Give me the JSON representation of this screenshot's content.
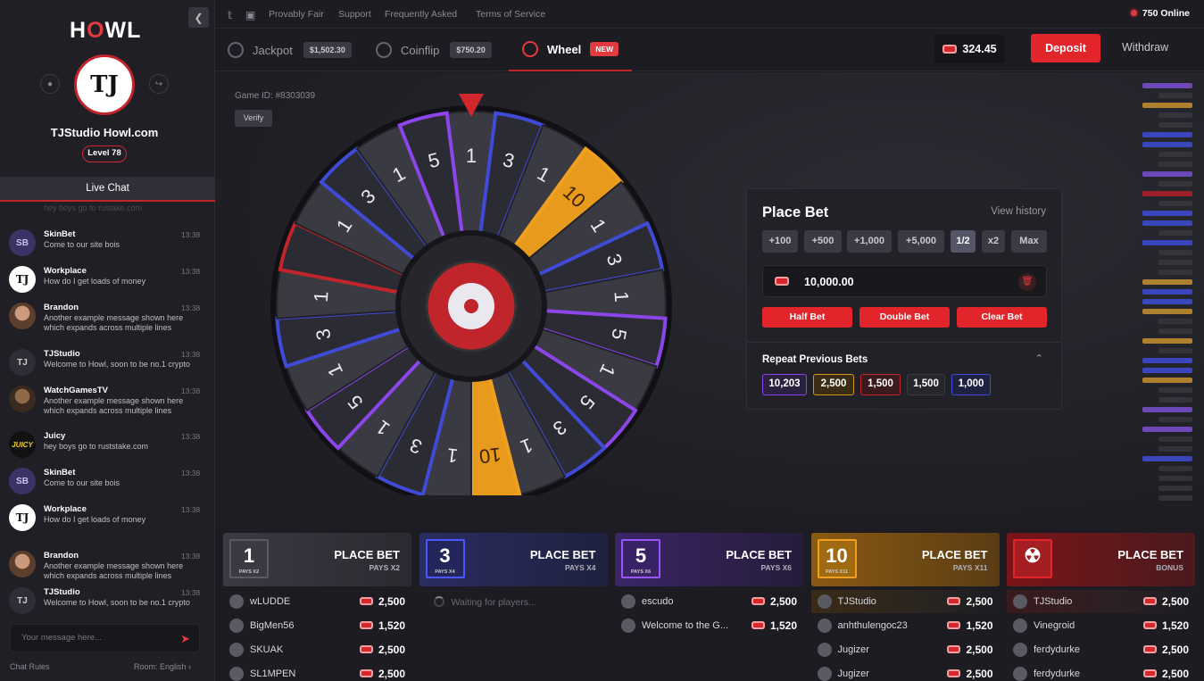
{
  "brand": {
    "h": "H",
    "o": "O",
    "wl": "WL"
  },
  "user": {
    "initials": "TJ",
    "name": "TJStudio Howl.com",
    "level": "Level 78"
  },
  "sidebar": {
    "tab": "Live Chat",
    "ghost": "hey boys go to rustake.com"
  },
  "chat": [
    {
      "name": "SkinBet",
      "time": "13:38",
      "text": "Come to our site bois",
      "av": "purple",
      "initials": "SB"
    },
    {
      "name": "Workplace",
      "time": "13:38",
      "text": "How do I get loads of money",
      "av": "white",
      "initials": "TJ"
    },
    {
      "name": "Brandon",
      "time": "13:38",
      "text": "Another example message shown here which expands across multiple lines",
      "av": "photo",
      "initials": ""
    },
    {
      "name": "TJStudio",
      "time": "13:38",
      "text": "Welcome to Howl, soon to be no.1 crypto",
      "av": "",
      "initials": "TJ"
    },
    {
      "name": "WatchGamesTV",
      "time": "13:38",
      "text": "Another example message shown here which expands across multiple lines",
      "av": "brown",
      "initials": ""
    },
    {
      "name": "Juicy",
      "time": "13:38",
      "text": "hey boys go to ruststake.com",
      "av": "juicy",
      "initials": "JUICY"
    },
    {
      "name": "SkinBet",
      "time": "13:38",
      "text": "Come to our site bois",
      "av": "purple",
      "initials": "SB"
    },
    {
      "name": "Workplace",
      "time": "13:38",
      "text": "How do I get loads of money",
      "av": "white",
      "initials": "TJ"
    },
    {
      "name": "Brandon",
      "time": "13:38",
      "text": "Another example message shown here which expands across multiple lines",
      "av": "photo",
      "initials": ""
    },
    {
      "name": "TJStudio",
      "time": "13:38",
      "text": "Welcome to Howl, soon to be no.1 crypto",
      "av": "",
      "initials": "TJ"
    }
  ],
  "chat_input": {
    "placeholder": "Your message here..."
  },
  "chat_footer": {
    "rules": "Chat Rules",
    "room": "Room: English"
  },
  "topbar": {
    "links": [
      "Provably Fair",
      "Support",
      "Frequently Asked",
      "Terms of Service"
    ],
    "online": "750 Online"
  },
  "nav": {
    "jackpot": {
      "label": "Jackpot",
      "amount": "$1,502.30"
    },
    "coinflip": {
      "label": "Coinflip",
      "amount": "$750.20"
    },
    "wheel": {
      "label": "Wheel",
      "badge": "NEW"
    },
    "balance": "324.45",
    "deposit": "Deposit",
    "withdraw": "Withdraw"
  },
  "game": {
    "id": "Game ID: #8303039",
    "verify": "Verify"
  },
  "wheel": {
    "segments": [
      "1",
      "3",
      "1",
      "10",
      "1",
      "3",
      "1",
      "5",
      "1",
      "5",
      "3",
      "1",
      "10",
      "1",
      "3",
      "1",
      "5",
      "1",
      "3",
      "1",
      "R",
      "1",
      "3",
      "1",
      "5"
    ]
  },
  "bet": {
    "title": "Place Bet",
    "history": "View history",
    "quick": [
      "+100",
      "+500",
      "+1,000",
      "+5,000",
      "1/2",
      "x2",
      "Max"
    ],
    "value": "10,000.00",
    "half": "Half Bet",
    "double": "Double Bet",
    "clear": "Clear Bet",
    "repeat_title": "Repeat Previous Bets",
    "previous": [
      "10,203",
      "2,500",
      "1,500",
      "1,500",
      "1,000"
    ]
  },
  "columns": [
    {
      "tile": "1",
      "tile_sub": "PAYS X2",
      "title": "PLACE BET",
      "sub": "PAYS X2",
      "rows": [
        {
          "name": "wLUDDE",
          "amt": "2,500"
        },
        {
          "name": "BigMen56",
          "amt": "1,520"
        },
        {
          "name": "SKUAK",
          "amt": "2,500"
        },
        {
          "name": "SL1MPEN",
          "amt": "2,500"
        }
      ]
    },
    {
      "tile": "3",
      "tile_sub": "PAYS X4",
      "title": "PLACE BET",
      "sub": "PAYS X4",
      "waiting": "Waiting for players...",
      "rows": []
    },
    {
      "tile": "5",
      "tile_sub": "PAYS X6",
      "title": "PLACE BET",
      "sub": "PAYS X6",
      "rows": [
        {
          "name": "escudo",
          "amt": "2,500"
        },
        {
          "name": "Welcome to the G...",
          "amt": "1,520"
        }
      ]
    },
    {
      "tile": "10",
      "tile_sub": "PAYS X11",
      "title": "PLACE BET",
      "sub": "PAYS X11",
      "rows": [
        {
          "name": "TJStudio",
          "amt": "2,500"
        },
        {
          "name": "anhthulengoc23",
          "amt": "1,520"
        },
        {
          "name": "Jugizer",
          "amt": "2,500"
        },
        {
          "name": "Jugizer",
          "amt": "2,500"
        }
      ]
    },
    {
      "tile": "",
      "tile_sub": "",
      "title": "PLACE BET",
      "sub": "BONUS",
      "rows": [
        {
          "name": "TJStudio",
          "amt": "2,500"
        },
        {
          "name": "Vinegroid",
          "amt": "1,520"
        },
        {
          "name": "ferdydurke",
          "amt": "2,500"
        },
        {
          "name": "ferdydurke",
          "amt": "2,500"
        }
      ]
    }
  ],
  "colors": {
    "accent": "#e2252b",
    "gray": "#3a3a42",
    "blue": "#3f4bd6",
    "purple": "#8b45e8",
    "gold": "#f0a020"
  }
}
